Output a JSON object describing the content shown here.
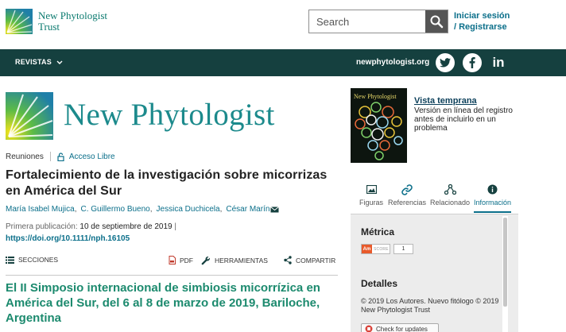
{
  "header": {
    "trust_name_line1": "New Phytologist",
    "trust_name_line2": "Trust",
    "search_placeholder": "Search",
    "login_line1": "Iniciar sesión",
    "login_line2": "/ Registrarse"
  },
  "nav": {
    "revistas_label": "REVISTAS",
    "site_label": "newphytologist.org",
    "social_linkedin": "in"
  },
  "journal": {
    "title": "New Phytologist"
  },
  "article": {
    "category": "Reuniones",
    "access": "Acceso Libre",
    "title": "Fortalecimiento de la investigación sobre micorrizas en América del Sur",
    "authors": [
      "María Isabel Mujica",
      "C. Guillermo Bueno",
      "Jessica Duchicela",
      "César Marín"
    ],
    "pub_label": "Primera publicación:",
    "pub_date": "10 de septiembre de 2019",
    "pub_sep": "|",
    "doi": "https://doi.org/10.1111/nph.16105"
  },
  "toolbar": {
    "sections": "SECCIONES",
    "pdf": "PDF",
    "tools": "HERRAMIENTAS",
    "share": "COMPARTIR"
  },
  "section": {
    "heading": "El II Simposio internacional de simbiosis micorrízica en América del Sur, del 6 al 8 de marzo de 2019, Bariloche, Argentina"
  },
  "sidebar": {
    "cover_title": "New Phytologist",
    "early_view_link": "Vista temprana",
    "early_view_desc": "Versión en línea del registro antes de incluirlo en un problema",
    "tabs": [
      {
        "label": "Figuras"
      },
      {
        "label": "Referencias"
      },
      {
        "label": "Relacionado"
      },
      {
        "label": "Información"
      }
    ],
    "metrics_heading": "Métrica",
    "altmetric_logo": "Am",
    "altmetric_score_label": "SCORE",
    "altmetric_score": "1",
    "details_heading": "Detalles",
    "copyright": "© 2019 Los Autores. Nuevo fitólogo © 2019 New Phytologist Trust",
    "updates_button": "Check for updates"
  },
  "colors": {
    "nav_bg": "#15403f",
    "accent_link": "#0b6f8a",
    "journal_teal": "#1c8a8c",
    "section_green": "#1c8a6e"
  }
}
